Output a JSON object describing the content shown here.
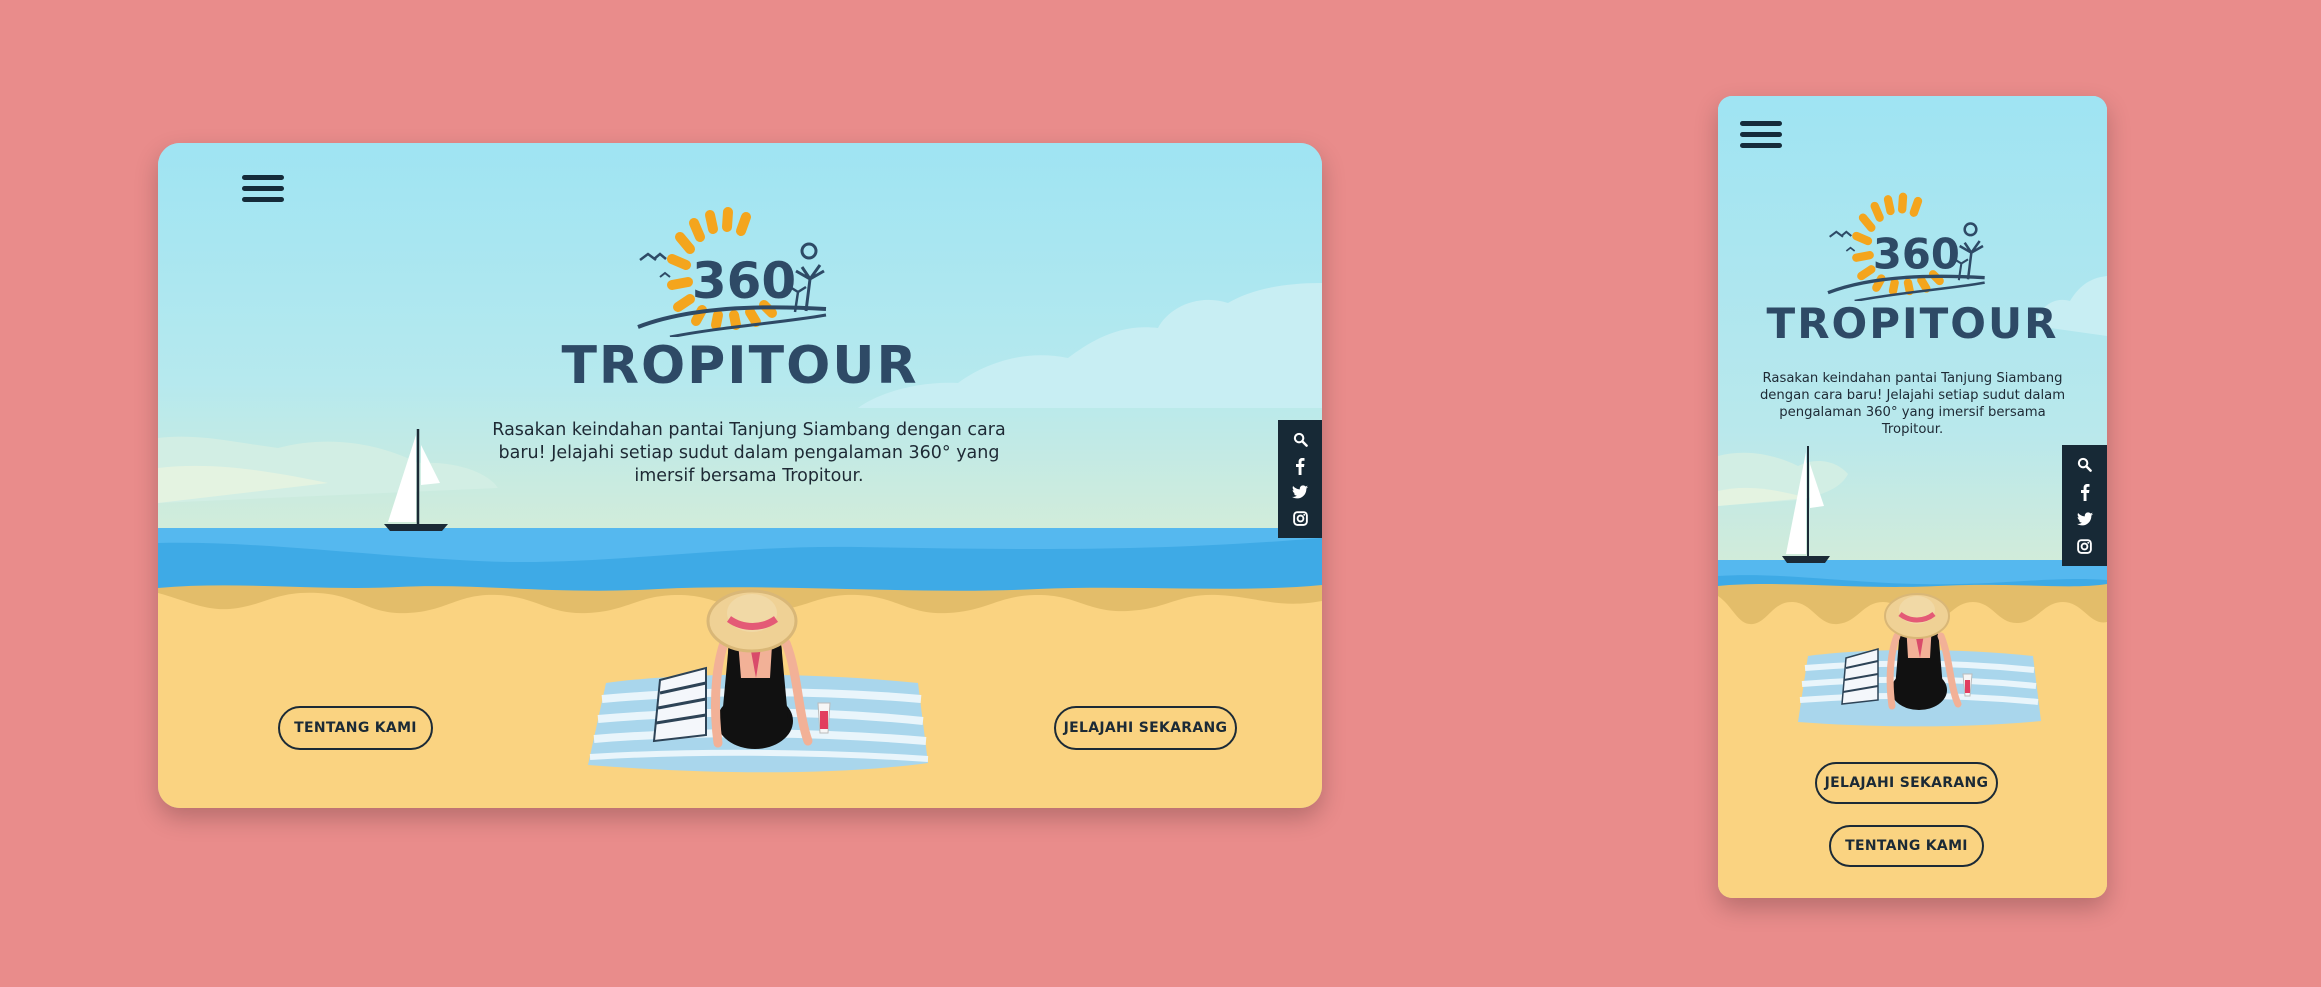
{
  "brand": {
    "name": "TROPITOUR",
    "logo_number": "360"
  },
  "hero": {
    "tagline": "Rasakan keindahan pantai Tanjung Siambang dengan cara baru! Jelajahi setiap sudut dalam pengalaman 360° yang imersif bersama Tropitour."
  },
  "nav": {
    "menu_icon": "hamburger-menu-icon"
  },
  "buttons": {
    "about": "TENTANG KAMI",
    "explore": "JELAJAHI SEKARANG"
  },
  "social": {
    "icons": [
      "search-icon",
      "facebook-icon",
      "twitter-icon",
      "instagram-icon"
    ]
  },
  "colors": {
    "background": "#e98c8b",
    "sky": "#9fe4f3",
    "sea": "#55b8ef",
    "sand": "#fad381",
    "brand": "#2e4a66",
    "sun": "#f4a51d",
    "dark": "#172936"
  }
}
